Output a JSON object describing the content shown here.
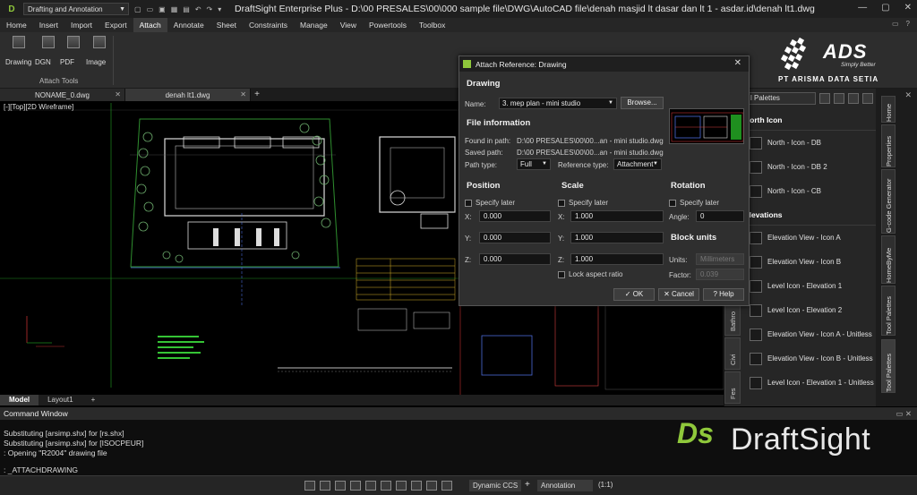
{
  "titlebar": {
    "workspace": "Drafting and Annotation",
    "title": "DraftSight Enterprise Plus - D:\\00 PRESALES\\00\\000 sample file\\DWG\\AutoCAD file\\denah masjid lt dasar dan lt 1 - asdar.id\\denah lt1.dwg"
  },
  "menu": [
    "Home",
    "Insert",
    "Import",
    "Export",
    "Attach",
    "Annotate",
    "Sheet",
    "Constraints",
    "Manage",
    "View",
    "Powertools",
    "Toolbox"
  ],
  "ribbon": {
    "buttons": [
      "Drawing",
      "DGN",
      "PDF",
      "Image"
    ],
    "group_label": "Attach Tools"
  },
  "brand": {
    "ads": "ADS",
    "tagline": "Simply Better",
    "company": "PT ARISMA DATA SETIA",
    "draftsight": "DraftSight"
  },
  "doc_tabs": [
    "NONAME_0.dwg",
    "denah lt1.dwg"
  ],
  "viewport": {
    "label": "[-][Top][2D Wireframe]"
  },
  "layout_tabs": [
    "Model",
    "Layout1"
  ],
  "command": {
    "header": "Command Window",
    "lines": [
      "Substituting [arsimp.shx] for [rs.shx]",
      "Substituting [arsimp.shx] for [ISOCPEUR]",
      ": Opening \"R2004\" drawing file"
    ],
    "input": ": _ATTACHDRAWING"
  },
  "status": {
    "dynamic_ccs": "Dynamic CCS",
    "annotation": "Annotation",
    "scale": "(1:1)"
  },
  "palette": {
    "dropdown": "l Palettes",
    "sections": [
      {
        "title": "North Icon",
        "items": [
          "North - Icon - DB",
          "North - Icon - DB 2",
          "North - Icon - CB"
        ]
      },
      {
        "title": "Elevations",
        "items": [
          "Elevation View - Icon A",
          "Elevation View - Icon B",
          "Level Icon - Elevation 1",
          "Level Icon - Elevation 2",
          "Elevation View - Icon A - Unitless",
          "Elevation View - Icon B - Unitless",
          "Level Icon - Elevation 1 - Unitless"
        ]
      }
    ],
    "vtabs": [
      "Bathro",
      "Civi",
      "Fes"
    ]
  },
  "right_tabs": [
    "Home",
    "Properties",
    "G-code Generator",
    "HomeByMe",
    "Tool Palettes",
    "Tool Palettes"
  ],
  "dialog": {
    "title": "Attach Reference: Drawing",
    "drawing_section": "Drawing",
    "name_label": "Name:",
    "name_value": "3. mep plan - mini studio",
    "browse": "Browse...",
    "file_info_section": "File information",
    "found_label": "Found in path:",
    "found_value": "D:\\00 PRESALES\\00\\00...an - mini studio.dwg",
    "saved_label": "Saved path:",
    "saved_value": "D:\\00 PRESALES\\00\\00...an - mini studio.dwg",
    "path_type_label": "Path type:",
    "path_type_value": "Full",
    "ref_type_label": "Reference type:",
    "ref_type_value": "Attachment",
    "position_section": "Position",
    "scale_section": "Scale",
    "rotation_section": "Rotation",
    "specify_later": "Specify later",
    "pos_x_label": "X:",
    "pos_x": "0.000",
    "pos_y_label": "Y:",
    "pos_y": "0.000",
    "pos_z_label": "Z:",
    "pos_z": "0.000",
    "scale_x_label": "X:",
    "scale_x": "1.000",
    "scale_y_label": "Y:",
    "scale_y": "1.000",
    "scale_z_label": "Z:",
    "scale_z": "1.000",
    "lock_aspect": "Lock aspect ratio",
    "angle_label": "Angle:",
    "angle": "0",
    "block_units_section": "Block units",
    "units_label": "Units:",
    "units": "Millimeters",
    "factor_label": "Factor:",
    "factor": "0.039",
    "ok": "OK",
    "cancel": "Cancel",
    "help": "Help"
  },
  "colors": {
    "accent_green": "#8fc83b",
    "background": "#000000",
    "panel": "#2f2f2f"
  }
}
